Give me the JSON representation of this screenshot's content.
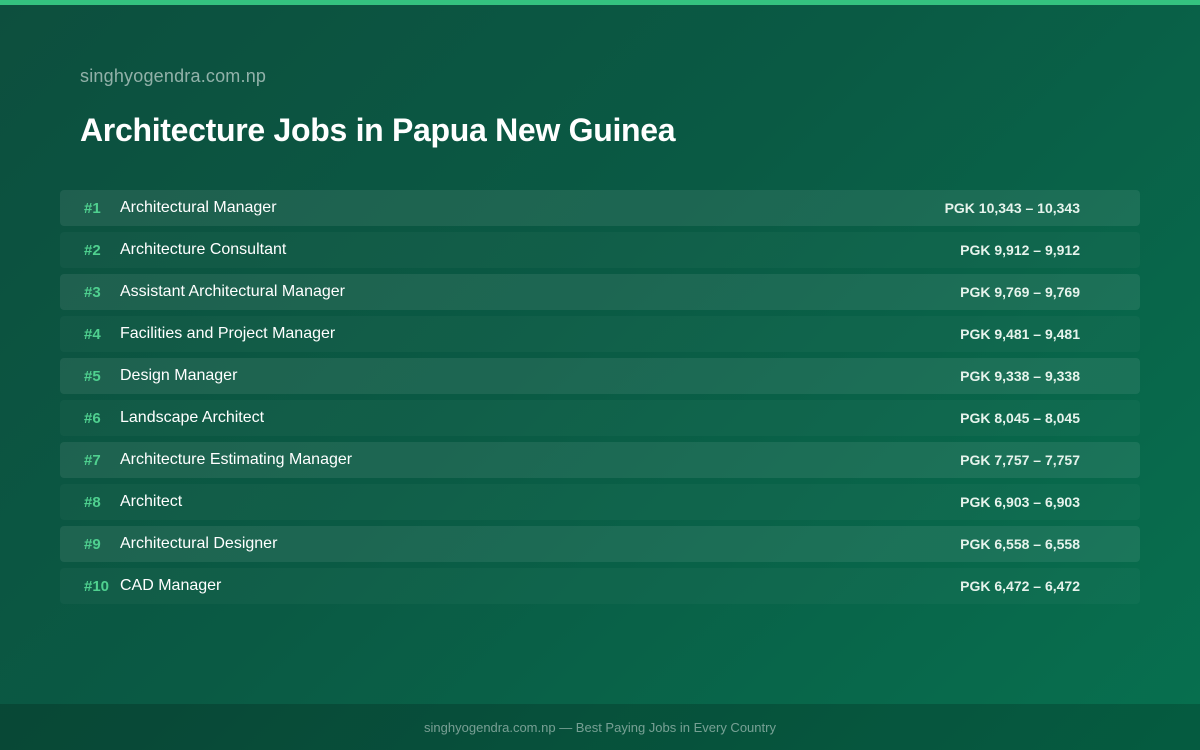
{
  "header": {
    "site_name": "singhyogendra.com.np",
    "title": "Architecture Jobs in Papua New Guinea"
  },
  "jobs": [
    {
      "rank": "#1",
      "title": "Architectural Manager",
      "salary": "PGK 10,343 – 10,343"
    },
    {
      "rank": "#2",
      "title": "Architecture Consultant",
      "salary": "PGK 9,912 – 9,912"
    },
    {
      "rank": "#3",
      "title": "Assistant Architectural Manager",
      "salary": "PGK 9,769 – 9,769"
    },
    {
      "rank": "#4",
      "title": "Facilities and Project Manager",
      "salary": "PGK 9,481 – 9,481"
    },
    {
      "rank": "#5",
      "title": "Design Manager",
      "salary": "PGK 9,338 – 9,338"
    },
    {
      "rank": "#6",
      "title": "Landscape Architect",
      "salary": "PGK 8,045 – 8,045"
    },
    {
      "rank": "#7",
      "title": "Architecture Estimating Manager",
      "salary": "PGK 7,757 – 7,757"
    },
    {
      "rank": "#8",
      "title": "Architect",
      "salary": "PGK 6,903 – 6,903"
    },
    {
      "rank": "#9",
      "title": "Architectural Designer",
      "salary": "PGK 6,558 – 6,558"
    },
    {
      "rank": "#10",
      "title": "CAD Manager",
      "salary": "PGK 6,472 – 6,472"
    }
  ],
  "footer": {
    "text": "singhyogendra.com.np — Best Paying Jobs in Every Country"
  },
  "colors": {
    "accent": "#34c27f",
    "rank": "#4fd08f",
    "background_start": "#0d4f3e",
    "background_end": "#07704f"
  }
}
